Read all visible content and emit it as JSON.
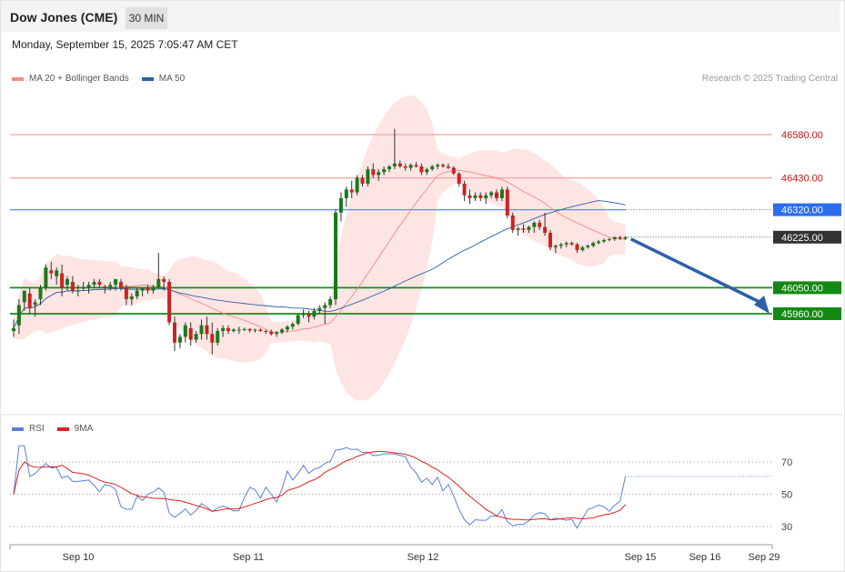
{
  "header": {
    "title": "Dow Jones (CME)",
    "timeframe": "30 MIN"
  },
  "datetime": "Monday, September 15, 2025 7:05:47 AM CET",
  "legend_main": [
    {
      "label": "MA 20 + Bollinger Bands",
      "color": "#f28b82"
    },
    {
      "label": "MA 50",
      "color": "#2f5fa7"
    }
  ],
  "legend_rsi": [
    {
      "label": "RSI",
      "color": "#5b7fd6"
    },
    {
      "label": "9MA",
      "color": "#e02020"
    }
  ],
  "copyright": "Research © 2025 Trading Central",
  "chart_data": [
    {
      "type": "candlestick",
      "levels": [
        {
          "value": 46580,
          "label": "46580.00",
          "kind": "resistance",
          "color": "#f4a3a3",
          "tag_color": "#cc1111"
        },
        {
          "value": 46430,
          "label": "46430.00",
          "kind": "resistance",
          "color": "#f4a3a3",
          "tag_color": "#cc1111"
        },
        {
          "value": 46320,
          "label": "46320.00",
          "kind": "pivot",
          "color": "#5b8ff0",
          "tag_color": "#2b6df0"
        },
        {
          "value": 46225,
          "label": "46225.00",
          "kind": "last",
          "color": "#444444",
          "tag_color": "#333333"
        },
        {
          "value": 46050,
          "label": "46050.00",
          "kind": "support",
          "color": "#1a8a1a",
          "tag_color": "#138913"
        },
        {
          "value": 45960,
          "label": "45960.00",
          "kind": "support",
          "color": "#1a8a1a",
          "tag_color": "#138913"
        }
      ],
      "forecast": {
        "from": 46225,
        "to": 45960,
        "direction": "down",
        "color": "#2f5fa7"
      },
      "x_labels": [
        "Sep 10",
        "Sep 11",
        "Sep 12",
        "Sep 15",
        "Sep 16",
        "Sep 29"
      ],
      "ohlc": [
        [
          45900,
          45940,
          45880,
          45910
        ],
        [
          45920,
          46010,
          45890,
          45990
        ],
        [
          46000,
          46030,
          45970,
          46040
        ],
        [
          46030,
          46050,
          45960,
          45980
        ],
        [
          45990,
          46010,
          45950,
          46000
        ],
        [
          46010,
          46060,
          45990,
          46050
        ],
        [
          46050,
          46130,
          46040,
          46120
        ],
        [
          46110,
          46140,
          46080,
          46100
        ],
        [
          46090,
          46120,
          46060,
          46110
        ],
        [
          46100,
          46130,
          46020,
          46050
        ],
        [
          46060,
          46090,
          46040,
          46080
        ],
        [
          46070,
          46090,
          46030,
          46040
        ],
        [
          46040,
          46060,
          46020,
          46040
        ],
        [
          46050,
          46070,
          46040,
          46050
        ],
        [
          46050,
          46070,
          46030,
          46060
        ],
        [
          46060,
          46080,
          46050,
          46070
        ],
        [
          46070,
          46080,
          46050,
          46060
        ],
        [
          46055,
          46060,
          46030,
          46050
        ],
        [
          46050,
          46070,
          46040,
          46060
        ],
        [
          46060,
          46080,
          46040,
          46080
        ],
        [
          46070,
          46080,
          46040,
          46050
        ],
        [
          46050,
          46060,
          45990,
          46010
        ],
        [
          46010,
          46030,
          45990,
          46020
        ],
        [
          46020,
          46050,
          46010,
          46040
        ],
        [
          46040,
          46050,
          46020,
          46050
        ],
        [
          46050,
          46060,
          46030,
          46040
        ],
        [
          46040,
          46060,
          46030,
          46050
        ],
        [
          46050,
          46170,
          46050,
          46080
        ],
        [
          46080,
          46090,
          46040,
          46070
        ],
        [
          46070,
          46080,
          45920,
          45930
        ],
        [
          45930,
          45950,
          45830,
          45860
        ],
        [
          45860,
          45890,
          45840,
          45880
        ],
        [
          45880,
          45930,
          45860,
          45920
        ],
        [
          45910,
          45930,
          45850,
          45870
        ],
        [
          45870,
          45900,
          45860,
          45890
        ],
        [
          45890,
          45940,
          45870,
          45920
        ],
        [
          45920,
          45950,
          45870,
          45890
        ],
        [
          45890,
          45930,
          45820,
          45860
        ],
        [
          45860,
          45910,
          45850,
          45900
        ],
        [
          45900,
          45920,
          45880,
          45910
        ],
        [
          45910,
          45920,
          45890,
          45900
        ],
        [
          45900,
          45910,
          45895,
          45905
        ],
        [
          45905,
          45915,
          45890,
          45905
        ],
        [
          45905,
          45912,
          45900,
          45907
        ],
        [
          45907,
          45910,
          45895,
          45902
        ],
        [
          45902,
          45908,
          45895,
          45905
        ],
        [
          45905,
          45910,
          45898,
          45900
        ],
        [
          45900,
          45905,
          45890,
          45898
        ],
        [
          45898,
          45905,
          45885,
          45890
        ],
        [
          45890,
          45900,
          45880,
          45895
        ],
        [
          45895,
          45910,
          45890,
          45905
        ],
        [
          45905,
          45920,
          45895,
          45915
        ],
        [
          45915,
          45930,
          45905,
          45925
        ],
        [
          45925,
          45960,
          45920,
          45955
        ],
        [
          45955,
          45975,
          45945,
          45960
        ],
        [
          45960,
          45970,
          45930,
          45950
        ],
        [
          45950,
          45980,
          45940,
          45970
        ],
        [
          45970,
          45990,
          45960,
          45980
        ],
        [
          45980,
          46000,
          45925,
          45990
        ],
        [
          45990,
          46020,
          45980,
          46010
        ],
        [
          46010,
          46320,
          45990,
          46310
        ],
        [
          46310,
          46380,
          46280,
          46360
        ],
        [
          46360,
          46400,
          46330,
          46390
        ],
        [
          46390,
          46420,
          46360,
          46380
        ],
        [
          46380,
          46440,
          46370,
          46430
        ],
        [
          46430,
          46440,
          46400,
          46410
        ],
        [
          46410,
          46470,
          46400,
          46460
        ],
        [
          46460,
          46480,
          46430,
          46440
        ],
        [
          46440,
          46460,
          46420,
          46450
        ],
        [
          46450,
          46470,
          46440,
          46460
        ],
        [
          46460,
          46475,
          46450,
          46470
        ],
        [
          46470,
          46600,
          46460,
          46480
        ],
        [
          46480,
          46490,
          46465,
          46470
        ],
        [
          46470,
          46480,
          46455,
          46465
        ],
        [
          46465,
          46480,
          46455,
          46475
        ],
        [
          46475,
          46485,
          46465,
          46470
        ],
        [
          46470,
          46480,
          46440,
          46450
        ],
        [
          46450,
          46465,
          46440,
          46460
        ],
        [
          46460,
          46475,
          46455,
          46470
        ],
        [
          46470,
          46480,
          46460,
          46475
        ],
        [
          46475,
          46480,
          46465,
          46470
        ],
        [
          46470,
          46480,
          46460,
          46465
        ],
        [
          46465,
          46470,
          46440,
          46445
        ],
        [
          46445,
          46450,
          46400,
          46410
        ],
        [
          46410,
          46420,
          46350,
          46370
        ],
        [
          46370,
          46390,
          46340,
          46360
        ],
        [
          46360,
          46380,
          46350,
          46370
        ],
        [
          46370,
          46380,
          46350,
          46360
        ],
        [
          46360,
          46380,
          46340,
          46370
        ],
        [
          46370,
          46385,
          46360,
          46380
        ],
        [
          46380,
          46390,
          46350,
          46360
        ],
        [
          46360,
          46400,
          46350,
          46390
        ],
        [
          46390,
          46400,
          46290,
          46300
        ],
        [
          46300,
          46310,
          46240,
          46250
        ],
        [
          46250,
          46260,
          46230,
          46255
        ],
        [
          46255,
          46270,
          46240,
          46250
        ],
        [
          46250,
          46265,
          46240,
          46260
        ],
        [
          46260,
          46280,
          46240,
          46275
        ],
        [
          46275,
          46285,
          46250,
          46260
        ],
        [
          46260,
          46310,
          46230,
          46240
        ],
        [
          46240,
          46250,
          46180,
          46190
        ],
        [
          46190,
          46200,
          46170,
          46195
        ],
        [
          46195,
          46205,
          46185,
          46200
        ],
        [
          46200,
          46210,
          46190,
          46205
        ],
        [
          46205,
          46210,
          46195,
          46200
        ],
        [
          46200,
          46205,
          46170,
          46180
        ],
        [
          46180,
          46195,
          46175,
          46190
        ],
        [
          46190,
          46200,
          46185,
          46195
        ],
        [
          46195,
          46210,
          46190,
          46205
        ],
        [
          46205,
          46215,
          46200,
          46210
        ],
        [
          46210,
          46220,
          46205,
          46215
        ],
        [
          46215,
          46222,
          46210,
          46218
        ],
        [
          46218,
          46228,
          46212,
          46225
        ],
        [
          46225,
          46230,
          46215,
          46220
        ],
        [
          46220,
          46228,
          46215,
          46225
        ]
      ]
    },
    {
      "type": "line",
      "yticks": [
        70,
        50,
        30
      ],
      "ylim": [
        15,
        85
      ]
    }
  ]
}
